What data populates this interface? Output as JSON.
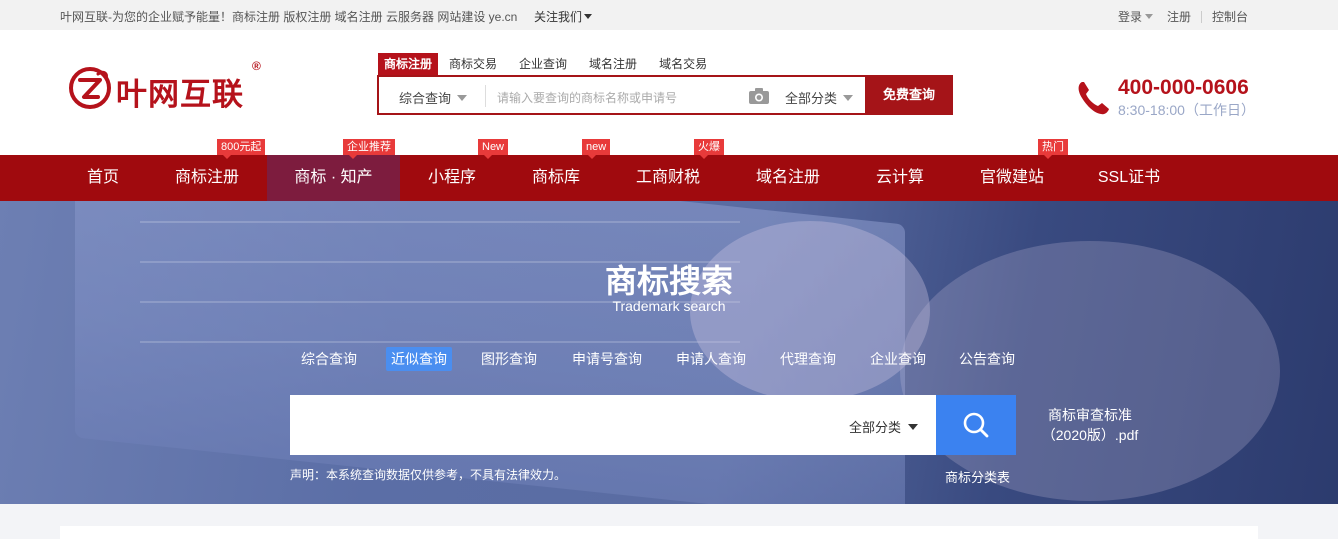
{
  "topbar": {
    "tagline": "叶网互联-为您的企业赋予能量！商标注册 版权注册 域名注册 云服务器 网站建设 ye.cn",
    "follow": "关注我们",
    "login": "登录",
    "register": "注册",
    "console": "控制台"
  },
  "logo": {
    "name": "叶网互联",
    "reg": "®"
  },
  "search": {
    "tabs": [
      "商标注册",
      "商标交易",
      "企业查询",
      "域名注册",
      "域名交易"
    ],
    "scope": "综合查询",
    "placeholder": "请输入要查询的商标名称或申请号",
    "category": "全部分类",
    "button": "免费查询"
  },
  "contact": {
    "phone": "400-000-0606",
    "hours": "8:30-18:00（工作日）"
  },
  "nav": {
    "items": [
      "首页",
      "商标注册",
      "商标 · 知产",
      "小程序",
      "商标库",
      "工商财税",
      "域名注册",
      "云计算",
      "官微建站",
      "SSL证书"
    ],
    "badges": [
      "800元起",
      "企业推荐",
      "New",
      "new",
      "火爆",
      "热门"
    ]
  },
  "hero": {
    "title": "商标搜索",
    "subtitle": "Trademark search",
    "tabs": [
      "综合查询",
      "近似查询",
      "图形查询",
      "申请号查询",
      "申请人查询",
      "代理查询",
      "企业查询",
      "公告查询"
    ],
    "category": "全部分类",
    "pdf_line1": "商标审查标准",
    "pdf_line2": "（2020版）.pdf",
    "notice": "声明：本系统查询数据仅供参考，不具有法律效力。",
    "class_table": "商标分类表"
  },
  "colors": {
    "brand": "#a00a0e",
    "active_tab": "#4a8ef0",
    "search_button": "#3b82f0"
  }
}
